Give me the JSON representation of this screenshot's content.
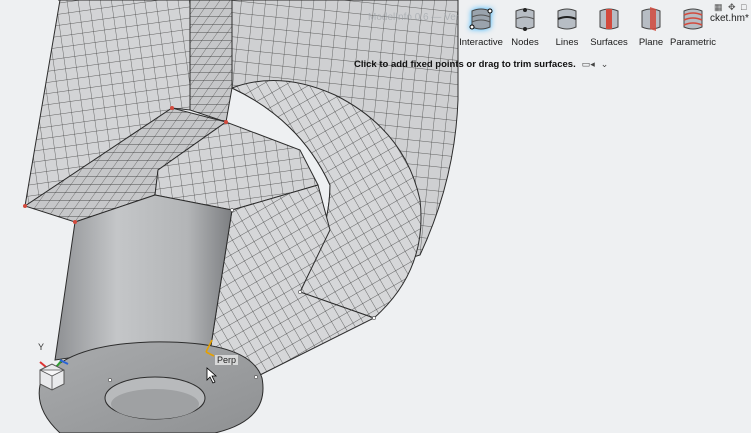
{
  "header": {
    "ghost_title": "ModelInfo 0.6 — Ver",
    "filename": "cket.hm*"
  },
  "toolbar": {
    "tools": [
      {
        "label": "Interactive",
        "icon": "interactive-icon",
        "active": true
      },
      {
        "label": "Nodes",
        "icon": "nodes-icon",
        "active": false
      },
      {
        "label": "Lines",
        "icon": "lines-icon",
        "active": false
      },
      {
        "label": "Surfaces",
        "icon": "surfaces-icon",
        "active": false
      },
      {
        "label": "Plane",
        "icon": "plane-icon",
        "active": false
      },
      {
        "label": "Parametric",
        "icon": "parametric-icon",
        "active": false
      }
    ]
  },
  "hint": {
    "text": "Click to add fixed points or drag to trim surfaces."
  },
  "viewport": {
    "snap_label": "Perp",
    "triad_axis": "Y",
    "view_cube_face": "FRONT"
  },
  "colors": {
    "background": "#eef0f2",
    "mesh_face": "#d3d4d6",
    "mesh_line": "#3b3b3b",
    "active_glow": "#37b5ff",
    "surface_red": "#d24a3d"
  }
}
